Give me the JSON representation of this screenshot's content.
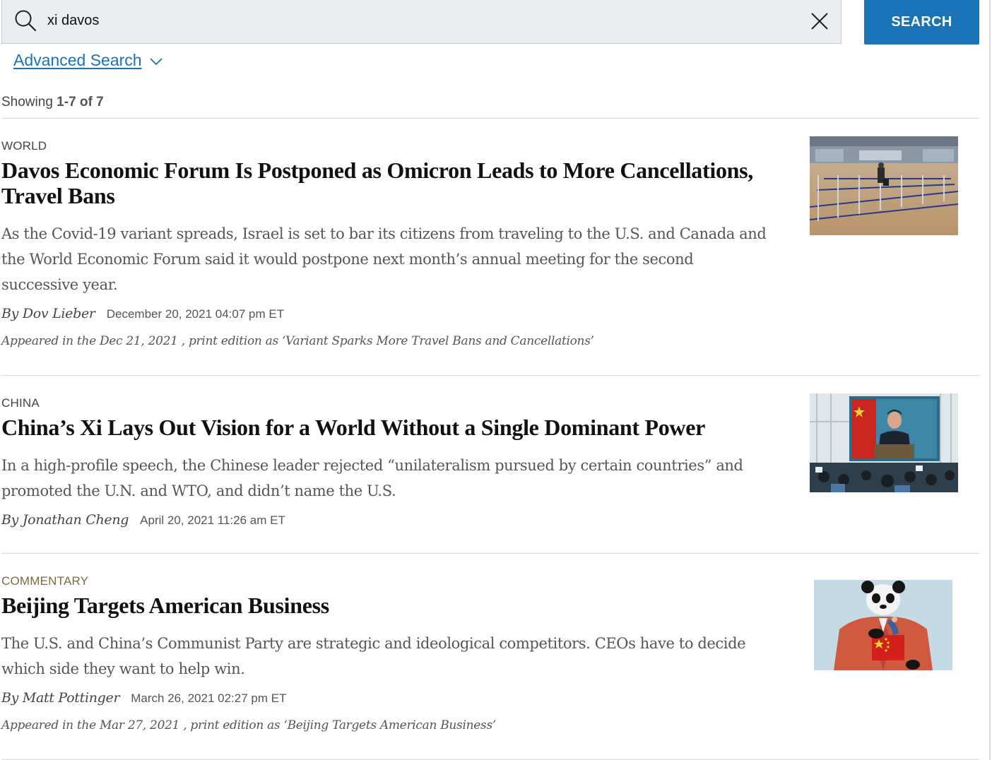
{
  "search": {
    "query": "xi davos",
    "button_label": "SEARCH",
    "advanced_label": "Advanced Search"
  },
  "results_summary": {
    "prefix": "Showing",
    "range": "1-7 of 7"
  },
  "articles": [
    {
      "category": "WORLD",
      "headline": "Davos Economic Forum Is Postponed as Omicron Leads to More Cancellations, Travel Bans",
      "summary": "As the Covid-19 variant spreads, Israel is set to bar its citizens from traveling to the U.S. and Canada and the World Economic Forum said it would postpone next month’s annual meeting for the second successive year.",
      "byline": "By Dov Lieber",
      "timestamp": "December 20, 2021 04:07 pm ET",
      "print_note": "Appeared in the Dec 21, 2021 , print edition as ‘Variant Sparks More Travel Bans and Cancellations’"
    },
    {
      "category": "CHINA",
      "headline": "China’s Xi Lays Out Vision for a World Without a Single Dominant Power",
      "summary": "In a high-profile speech, the Chinese leader rejected “unilateralism pursued by certain countries” and promoted the U.N. and WTO, and didn’t name the U.S.",
      "byline": "By Jonathan Cheng",
      "timestamp": "April 20, 2021 11:26 am ET"
    },
    {
      "category": "COMMENTARY",
      "headline": "Beijing Targets American Business",
      "summary": "The U.S. and China’s Communist Party are strategic and ideological competitors. CEOs have to decide which side they want to help win.",
      "byline": "By Matt Pottinger",
      "timestamp": "March 26, 2021 02:27 pm ET",
      "print_note": "Appeared in the Mar 27, 2021 , print edition as ‘Beijing Targets American Business’"
    }
  ],
  "colors": {
    "accent": "#1a73b6",
    "commentary": "#7b6a46",
    "search_bg": "#ebeef0"
  }
}
